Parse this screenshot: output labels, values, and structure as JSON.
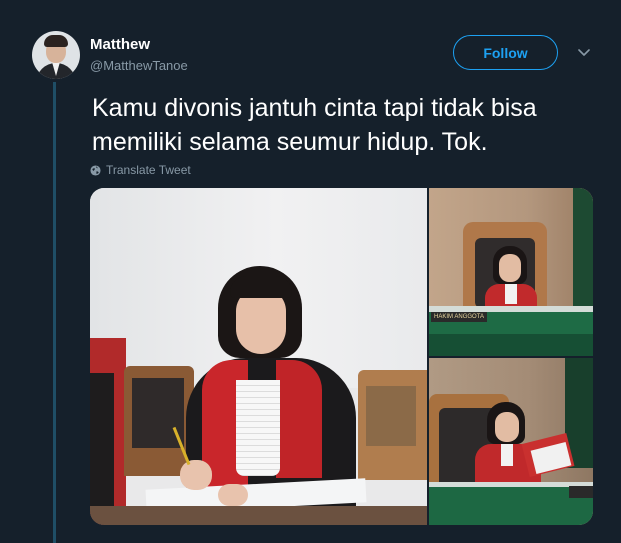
{
  "tweet": {
    "author_name": "Matthew",
    "author_handle": "@MatthewTanoe",
    "follow_label": "Follow",
    "text_lines": [
      "Kamu divonis jantuh cinta tapi tidak bisa",
      "memiliki selama seumur hidup. Tok."
    ],
    "translate_label": "Translate Tweet"
  },
  "icons": {
    "more_menu": "chevron-down-icon",
    "translate": "globe-icon"
  },
  "colors": {
    "background": "#15202b",
    "accent": "#1da1f2",
    "secondary_text": "#8899a6",
    "thread_line": "#1f4e66"
  },
  "media": {
    "photo_count": 3,
    "nameplate_text": "HAKIM ANGGOTA"
  }
}
